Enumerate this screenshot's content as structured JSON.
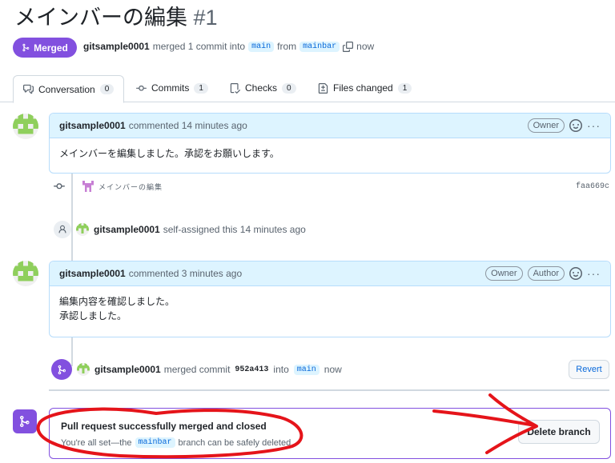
{
  "header": {
    "title": "メインバーの編集",
    "number": "#1",
    "status_badge": "Merged",
    "author": "gitsample0001",
    "merge_text": "merged 1 commit into",
    "base_branch": "main",
    "from_text": "from",
    "head_branch": "mainbar",
    "time": "now"
  },
  "tabs": [
    {
      "label": "Conversation",
      "count": "0"
    },
    {
      "label": "Commits",
      "count": "1"
    },
    {
      "label": "Checks",
      "count": "0"
    },
    {
      "label": "Files changed",
      "count": "1"
    }
  ],
  "comment1": {
    "author": "gitsample0001",
    "action": "commented 14 minutes ago",
    "badge_owner": "Owner",
    "body": "メインバーを編集しました。承認をお願いします。"
  },
  "commit_event": {
    "message": "メインバーの編集",
    "sha": "faa669c"
  },
  "assign_event": {
    "author": "gitsample0001",
    "text": "self-assigned this 14 minutes ago"
  },
  "comment2": {
    "author": "gitsample0001",
    "action": "commented 3 minutes ago",
    "badge_owner": "Owner",
    "badge_author": "Author",
    "body_line1": "編集内容を確認しました。",
    "body_line2": "承認しました。"
  },
  "merge_event": {
    "author": "gitsample0001",
    "text": "merged commit",
    "sha": "952a413",
    "into": "into",
    "branch": "main",
    "time": "now",
    "revert_label": "Revert"
  },
  "merged_box": {
    "title": "Pull request successfully merged and closed",
    "text_before": "You're all set—the",
    "branch": "mainbar",
    "text_after": "branch can be safely deleted.",
    "delete_label": "Delete branch"
  },
  "colors": {
    "merged_purple": "#8250df",
    "link_blue": "#0969da",
    "annotation_red": "#e5141a",
    "comment_header_bg": "#ddf4ff"
  }
}
